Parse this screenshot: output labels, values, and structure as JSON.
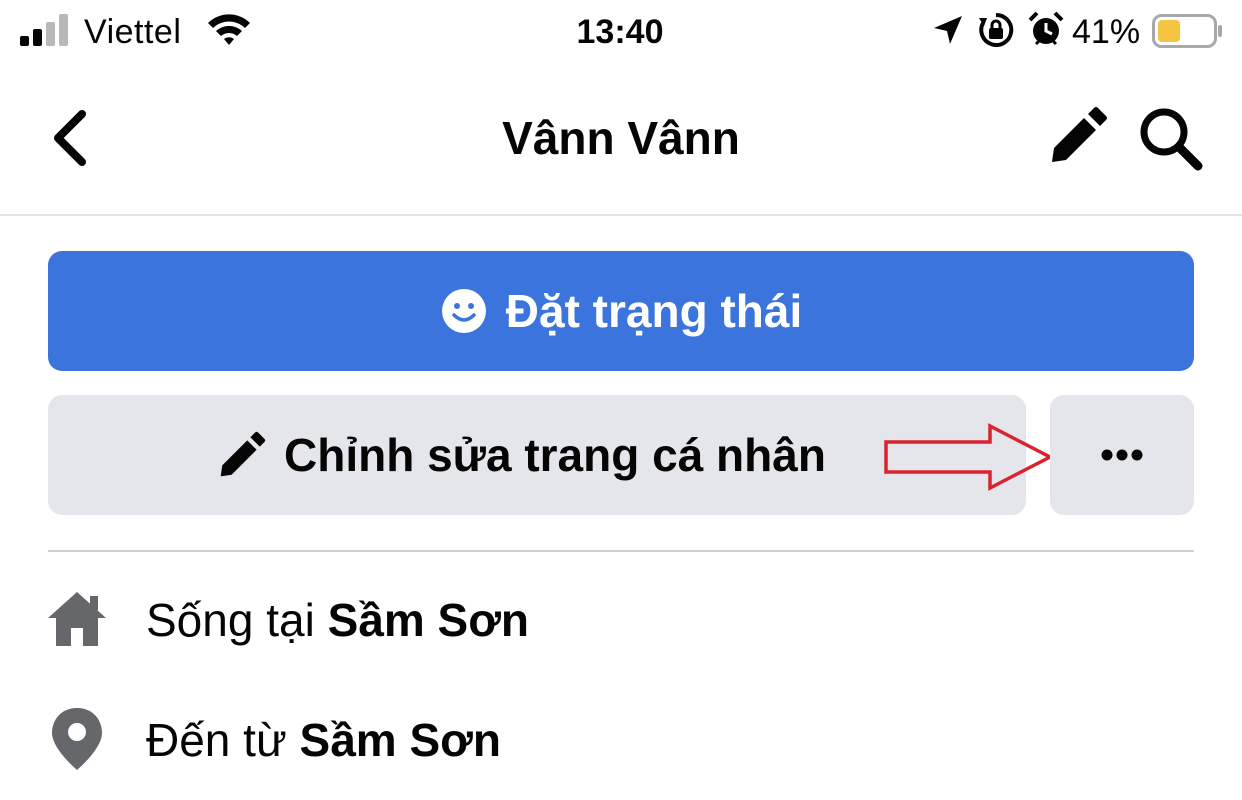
{
  "status_bar": {
    "carrier": "Viettel",
    "time": "13:40",
    "battery_percent": "41%",
    "battery_level": 0.41,
    "battery_color": "#f5c542",
    "icons": [
      "signal-icon",
      "wifi-icon",
      "location-icon",
      "rotation-lock-icon",
      "alarm-icon",
      "battery-icon"
    ]
  },
  "header": {
    "title": "Vânn Vânn",
    "back_icon": "chevron-left-icon",
    "edit_icon": "pencil-icon",
    "search_icon": "search-icon"
  },
  "actions": {
    "status_label": "Đặt trạng thái",
    "status_icon": "smiley-icon",
    "edit_profile_label": "Chỉnh sửa trang cá nhân",
    "edit_profile_icon": "pencil-icon",
    "more_icon": "more-horizontal-icon",
    "primary_color": "#3b74dd",
    "secondary_bg": "#e4e6eb",
    "annotation_arrow_color": "#d9232e"
  },
  "info": {
    "lives_prefix": "Sống tại",
    "lives_place": "Sầm Sơn",
    "lives_icon": "home-icon",
    "from_prefix": "Đến từ",
    "from_place": "Sầm Sơn",
    "from_icon": "location-pin-icon"
  }
}
